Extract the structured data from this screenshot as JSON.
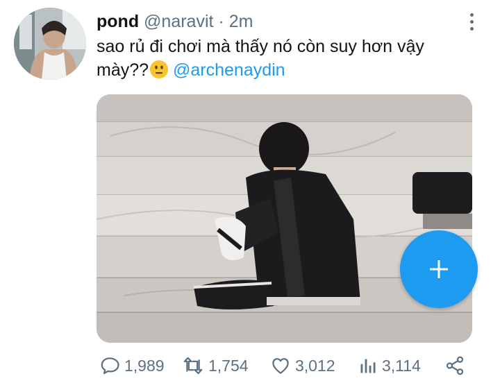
{
  "tweet": {
    "author_name": "pond",
    "author_handle": "@naravit",
    "separator": "·",
    "time_ago": "2m",
    "text_before_emoji": "sao rủ đi chơi mà thấy nó còn suy hơn vậy mày??",
    "emoji_icon": "neutral-face-emoji",
    "mention": "@archenaydin"
  },
  "media": {
    "icon": "photo"
  },
  "actions": {
    "replies": "1,989",
    "retweets": "1,754",
    "likes": "3,012",
    "views": "3,114"
  },
  "colors": {
    "accent": "#1d9bf0",
    "text_primary": "#0f1419",
    "text_secondary": "#5b7083"
  },
  "compose_button": {
    "icon": "plus-icon"
  }
}
